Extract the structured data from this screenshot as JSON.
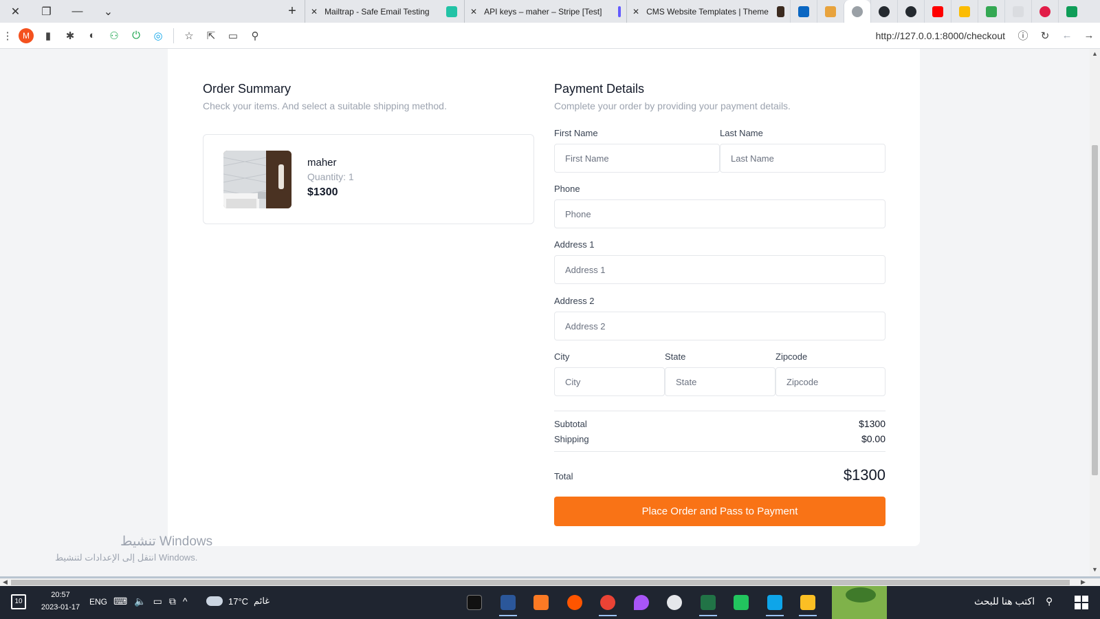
{
  "browser": {
    "tabs": [
      {
        "label": "Mailtrap - Safe Email Testing",
        "fav_color": "#22c3a6"
      },
      {
        "label": "API keys – maher – Stripe [Test]",
        "fav_color": "#635bff"
      },
      {
        "label": "CMS Website Templates | Theme",
        "fav_color": "#3b2a1f"
      }
    ],
    "pinned_colors": [
      "#0a66c2",
      "#e8a33d",
      "#9aa0a6",
      "#24292f",
      "#24292f",
      "#ff0000",
      "#fbbc04",
      "#34a853",
      "#dadce0",
      "#e11d48",
      "#0f9d58"
    ],
    "profile_initial": "M",
    "url": "http://127.0.0.1:8000/checkout"
  },
  "order": {
    "title": "Order Summary",
    "subtitle": "Check your items. And select a suitable shipping method.",
    "item": {
      "name": "maher",
      "quantity": "Quantity: 1",
      "price": "$1300"
    }
  },
  "payment": {
    "title": "Payment Details",
    "subtitle": "Complete your order by providing your payment details.",
    "fields": {
      "first_name": {
        "label": "First Name",
        "placeholder": "First Name"
      },
      "last_name": {
        "label": "Last Name",
        "placeholder": "Last Name"
      },
      "phone": {
        "label": "Phone",
        "placeholder": "Phone"
      },
      "address1": {
        "label": "Address 1",
        "placeholder": "Address 1"
      },
      "address2": {
        "label": "Address 2",
        "placeholder": "Address 2"
      },
      "city": {
        "label": "City",
        "placeholder": "City"
      },
      "state": {
        "label": "State",
        "placeholder": "State"
      },
      "zipcode": {
        "label": "Zipcode",
        "placeholder": "Zipcode"
      }
    },
    "subtotal_label": "Subtotal",
    "subtotal_value": "$1300",
    "shipping_label": "Shipping",
    "shipping_value": "$0.00",
    "total_label": "Total",
    "total_value": "$1300",
    "submit_label": "Place Order and Pass to Payment",
    "accent": "#f97316"
  },
  "watermark": {
    "line1": "تنشيط Windows",
    "line2": "انتقل إلى الإعدادات لتنشيط Windows."
  },
  "taskbar": {
    "notification_count": "10",
    "time": "20:57",
    "date": "2023-01-17",
    "language": "ENG",
    "temperature": "17°C",
    "weather": "غائم",
    "search_placeholder": "اكتب هنا للبحث"
  }
}
